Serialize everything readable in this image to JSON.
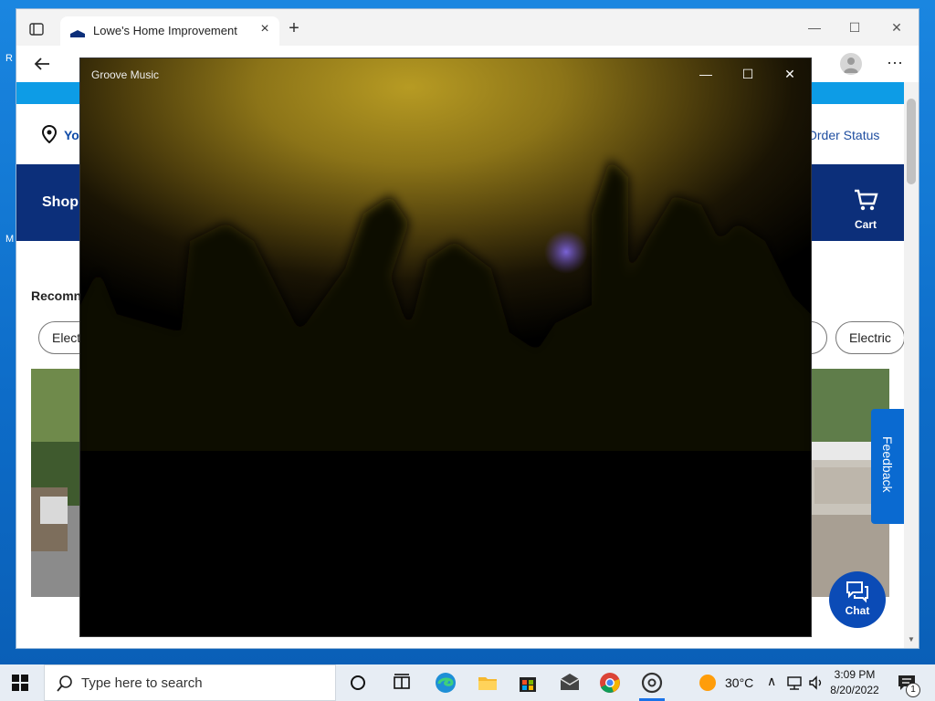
{
  "browser": {
    "tab_title": "Lowe's Home Improvement",
    "tab_close": "×",
    "new_tab": "+",
    "win_min": "—",
    "win_max": "☐",
    "win_close": "✕",
    "more": "⋯"
  },
  "lowes": {
    "location_text": "Yo",
    "order_status": "Order Status",
    "shop_label": "Shop",
    "cart_label": "Cart",
    "recommend_label": "Recomn",
    "chips": [
      "Electr",
      "Electric"
    ],
    "feedback": "Feedback",
    "chat": "Chat"
  },
  "groove": {
    "title": "Groove Music",
    "min": "—",
    "max": "☐",
    "close": "✕"
  },
  "taskbar": {
    "search_placeholder": "Type here to search",
    "weather": "30°C",
    "time": "3:09 PM",
    "date": "8/20/2022",
    "notif_count": "1",
    "tray_chevron": "∧"
  },
  "desktop": {
    "fragment_r": "R",
    "fragment_m": "M"
  },
  "colors": {
    "lowes_navy": "#0c2f7a",
    "lowes_blue": "#0d9ce6",
    "feedback_blue": "#0a6ad1"
  }
}
